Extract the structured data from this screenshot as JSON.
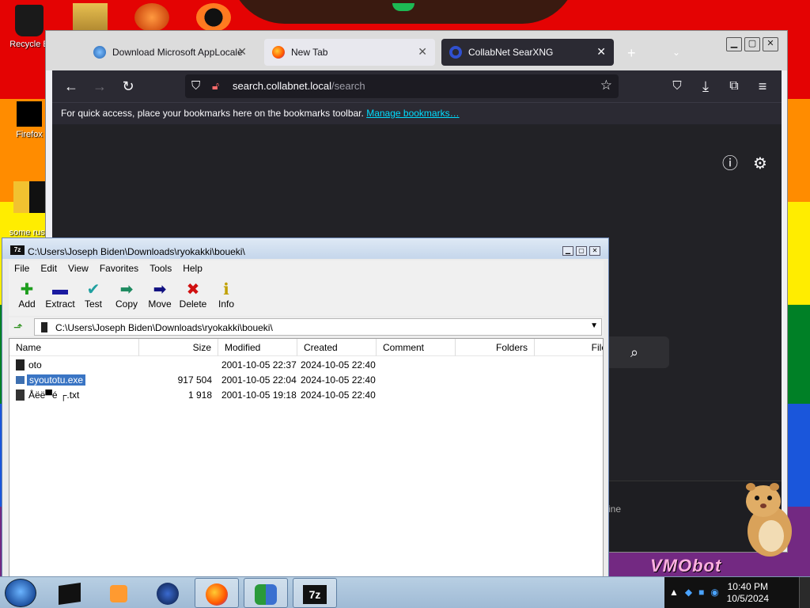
{
  "desktop": {
    "icons": [
      {
        "label": "Recycle B"
      },
      {
        "label": "Firefox"
      },
      {
        "label": "some russ\nran a ra"
      }
    ],
    "watermark": "VMObot"
  },
  "firefox": {
    "tabs": [
      {
        "label": "Download Microsoft AppLocale"
      },
      {
        "label": "New Tab"
      },
      {
        "label": "CollabNet SearXNG"
      }
    ],
    "url_host": "search.collabnet.local",
    "url_path": "/search",
    "bookmarks_hint": "For quick access, place your bookmarks here on the bookmarks toolbar.",
    "bookmarks_link": "Manage bookmarks…",
    "footer_fragment": "ine"
  },
  "sevenzip": {
    "logo": "7z",
    "title": "C:\\Users\\Joseph Biden\\Downloads\\ryokakki\\boueki\\",
    "menu": [
      "File",
      "Edit",
      "View",
      "Favorites",
      "Tools",
      "Help"
    ],
    "tools": [
      {
        "label": "Add",
        "icon": "plus-icon",
        "color": "#1e9e1e"
      },
      {
        "label": "Extract",
        "icon": "minus-icon",
        "color": "#1a1aa0"
      },
      {
        "label": "Test",
        "icon": "check-icon",
        "color": "#20a0a0"
      },
      {
        "label": "Copy",
        "icon": "copy-arrow-icon",
        "color": "#1e8a60"
      },
      {
        "label": "Move",
        "icon": "move-arrow-icon",
        "color": "#101080"
      },
      {
        "label": "Delete",
        "icon": "delete-x-icon",
        "color": "#d01010"
      },
      {
        "label": "Info",
        "icon": "info-icon",
        "color": "#c0a000"
      }
    ],
    "path": "C:\\Users\\Joseph Biden\\Downloads\\ryokakki\\boueki\\",
    "columns": [
      "Name",
      "Size",
      "Modified",
      "Created",
      "Comment",
      "Folders",
      "File"
    ],
    "rows": [
      {
        "name": "oto",
        "size": "",
        "modified": "2001-10-05 22:37",
        "created": "2024-10-05 22:40",
        "icon": "folder-icon"
      },
      {
        "name": "syoutotu.exe",
        "size": "917 504",
        "modified": "2001-10-05 22:04",
        "created": "2024-10-05 22:40",
        "icon": "exe-icon",
        "selected": true
      },
      {
        "name": "Åëë▀é ┌.txt",
        "size": "1 918",
        "modified": "2001-10-05 19:18",
        "created": "2024-10-05 22:40",
        "icon": "txt-icon"
      }
    ]
  },
  "taskbar": {
    "time": "10:40 PM",
    "date": "10/5/2024"
  }
}
